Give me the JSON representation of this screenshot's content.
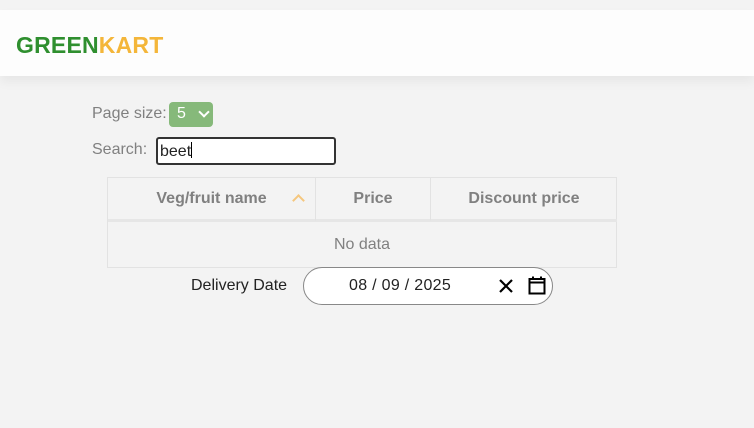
{
  "brand": {
    "part1": "GREEN",
    "part2": "KART",
    "color1": "#2f8f2f",
    "color2": "#f4b63a"
  },
  "controls": {
    "page_size_label": "Page size:",
    "page_size_value": "5",
    "search_label": "Search:",
    "search_value": "beet"
  },
  "table": {
    "columns": [
      "Veg/fruit name",
      "Price",
      "Discount price"
    ],
    "sorted_column": "Veg/fruit name",
    "sort_direction": "ascending",
    "empty_text": "No data"
  },
  "delivery": {
    "label": "Delivery Date",
    "value": "08 / 09 / 2025"
  },
  "icons": {
    "sort": "chevron-up-icon",
    "clear": "close-icon",
    "calendar": "calendar-icon"
  }
}
